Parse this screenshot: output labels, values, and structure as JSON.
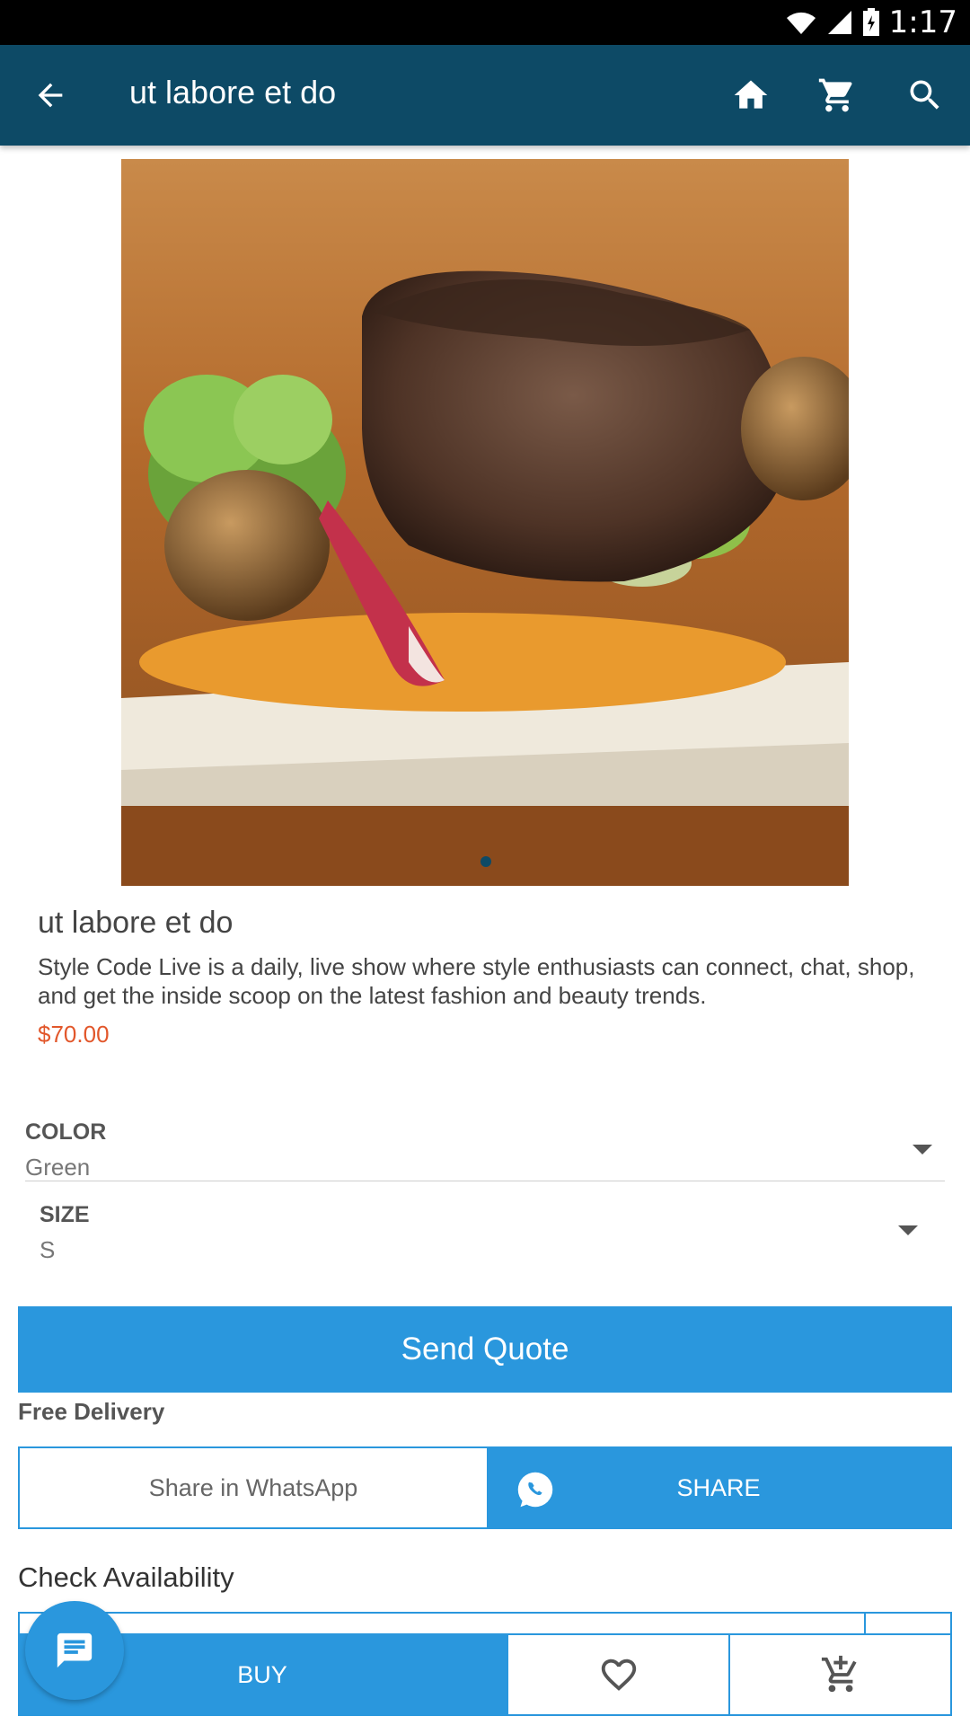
{
  "status_bar": {
    "time": "1:17"
  },
  "toolbar": {
    "title": "ut labore et do"
  },
  "product": {
    "name": "ut labore et do",
    "description": "Style Code Live is a daily, live show where style enthusiasts can connect, chat, shop, and get the inside scoop on the latest fashion and beauty trends.",
    "price": "$70.00"
  },
  "options": {
    "color": {
      "label": "COLOR",
      "value": "Green"
    },
    "size": {
      "label": "SIZE",
      "value": "S"
    }
  },
  "actions": {
    "send_quote": "Send Quote",
    "free_delivery": "Free Delivery",
    "share_whatsapp": "Share in WhatsApp",
    "share": "SHARE",
    "check_availability": "Check Availability",
    "buy": "BUY"
  },
  "colors": {
    "app_bar": "#0d4a66",
    "accent_blue": "#2a97dd",
    "price": "#e2572b"
  },
  "icons": [
    "back-arrow-icon",
    "home-icon",
    "cart-icon",
    "search-icon",
    "whatsapp-icon",
    "chat-icon",
    "heart-icon",
    "add-to-cart-icon"
  ]
}
